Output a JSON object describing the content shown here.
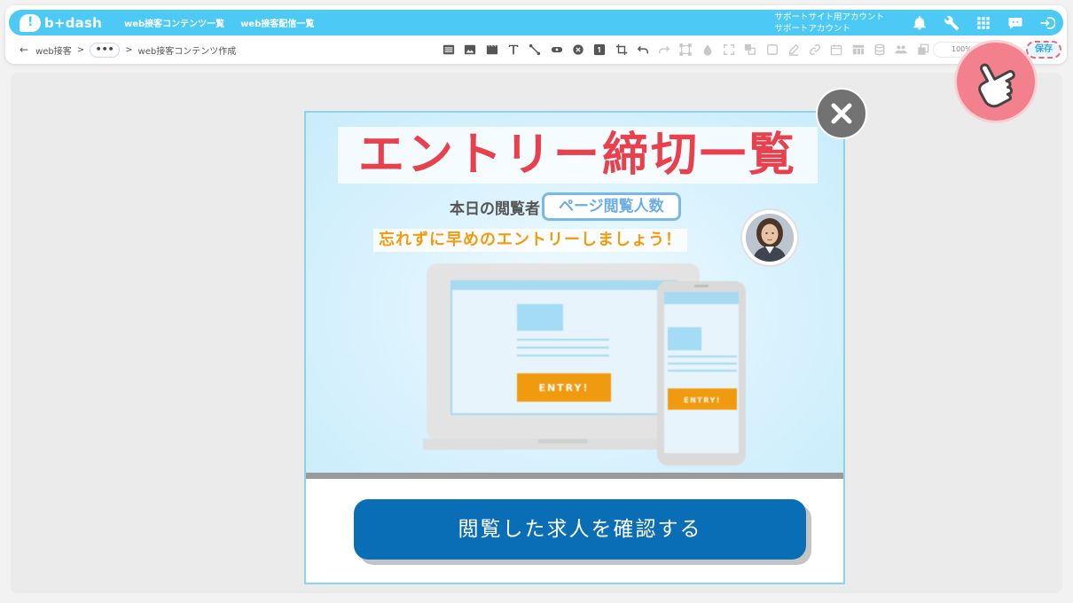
{
  "navbar": {
    "logo": "b+dash",
    "links": [
      "web接客コンテンツ一覧",
      "web接客配信一覧"
    ],
    "account_line1": "サポートサイト用アカウント",
    "account_line2": "サポートアカウント",
    "icons": [
      "bell-icon",
      "wrench-icon",
      "apps-grid-icon",
      "chat-support-icon",
      "logout-icon"
    ]
  },
  "breadcrumb": {
    "root": "web接客",
    "separator": ">",
    "ellipsis": "•••",
    "current": "web接客コンテンツ作成"
  },
  "toolbar": {
    "icons": [
      "list-icon",
      "image-icon",
      "video-icon",
      "text-icon",
      "line-icon",
      "badge-icon",
      "close-circle-icon",
      "number-icon",
      "crop-icon",
      "undo-icon",
      "redo-icon",
      "resize-icon",
      "drop-icon",
      "fullscreen-icon",
      "layers-icon",
      "square-icon",
      "pen-icon",
      "link-icon",
      "calendar-icon",
      "table-icon",
      "database-icon",
      "users-icon",
      "copy-icon"
    ],
    "zoom_label": "100%",
    "save_label": "保存"
  },
  "popup": {
    "title": "エントリー締切一覧",
    "viewer_label": "本日の閲覧者",
    "viewer_value": "ページ閲覧人数",
    "reminder": "忘れずに早めのエントリーしましょう！",
    "entry_label": "ENTRY!",
    "cta_label": "閲覧した求人を確認する"
  },
  "colors": {
    "nav": "#4ccaf5",
    "title": "#e8404d",
    "reminder": "#f59a0a",
    "cta": "#0a6eb7",
    "entry": "#f09a10"
  }
}
